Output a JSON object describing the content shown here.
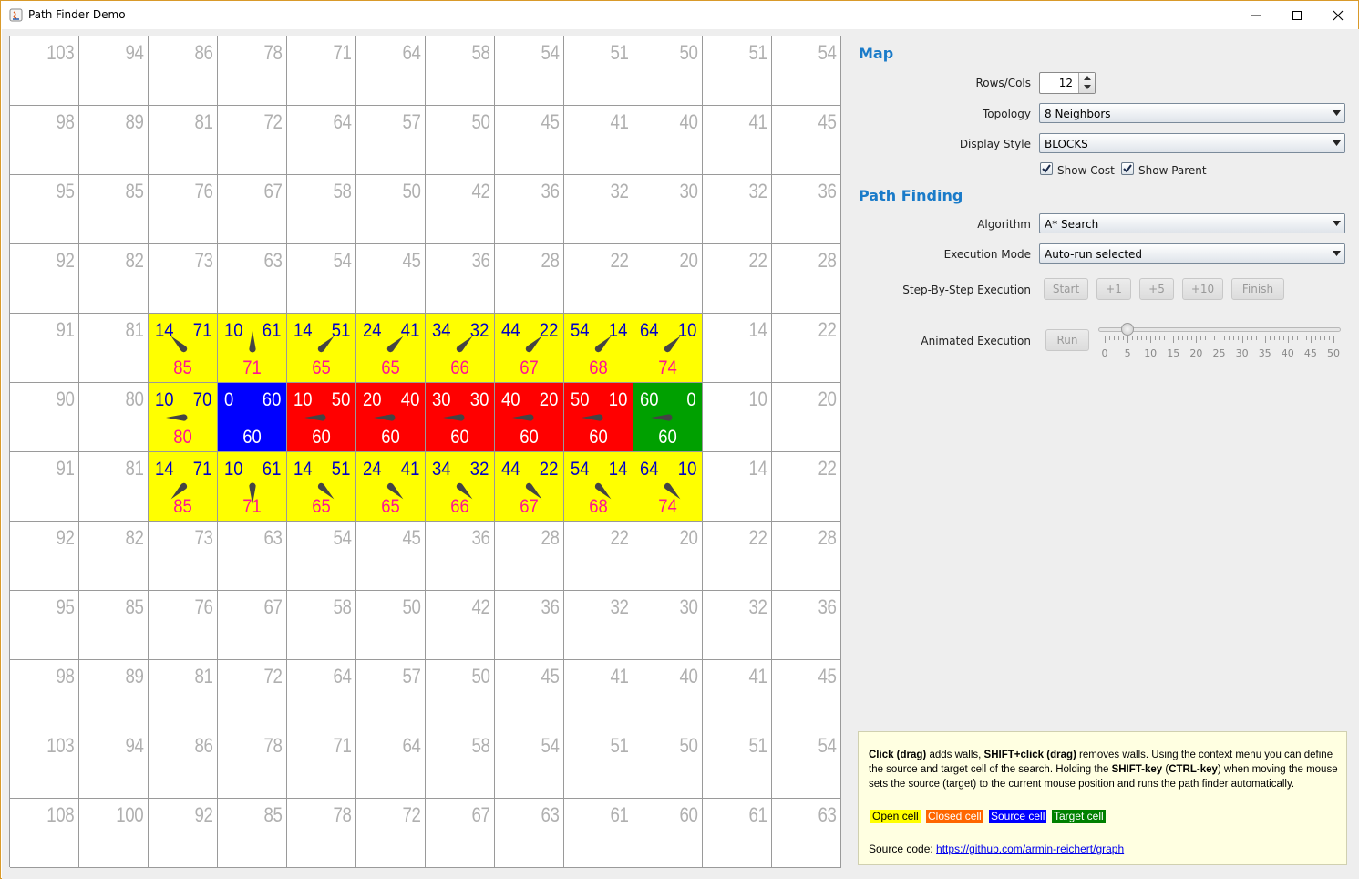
{
  "window": {
    "title": "Path Finder Demo",
    "controls": [
      "minimize",
      "maximize",
      "close"
    ]
  },
  "grid": {
    "rows": 12,
    "cols": 12,
    "h_values": [
      [
        "103",
        "94",
        "86",
        "78",
        "71",
        "64",
        "58",
        "54",
        "51",
        "50",
        "51",
        "54"
      ],
      [
        "98",
        "89",
        "81",
        "72",
        "64",
        "57",
        "50",
        "45",
        "41",
        "40",
        "41",
        "45"
      ],
      [
        "95",
        "85",
        "76",
        "67",
        "58",
        "50",
        "42",
        "36",
        "32",
        "30",
        "32",
        "36"
      ],
      [
        "92",
        "82",
        "73",
        "63",
        "54",
        "45",
        "36",
        "28",
        "22",
        "20",
        "22",
        "28"
      ],
      [
        "91",
        "81",
        "",
        "",
        "",
        "",
        "",
        "",
        "",
        "",
        "14",
        "22"
      ],
      [
        "90",
        "80",
        "",
        "",
        "",
        "",
        "",
        "",
        "",
        "",
        "10",
        "20"
      ],
      [
        "91",
        "81",
        "",
        "",
        "",
        "",
        "",
        "",
        "",
        "",
        "14",
        "22"
      ],
      [
        "92",
        "82",
        "73",
        "63",
        "54",
        "45",
        "36",
        "28",
        "22",
        "20",
        "22",
        "28"
      ],
      [
        "95",
        "85",
        "76",
        "67",
        "58",
        "50",
        "42",
        "36",
        "32",
        "30",
        "32",
        "36"
      ],
      [
        "98",
        "89",
        "81",
        "72",
        "64",
        "57",
        "50",
        "45",
        "41",
        "40",
        "41",
        "45"
      ],
      [
        "103",
        "94",
        "86",
        "78",
        "71",
        "64",
        "58",
        "54",
        "51",
        "50",
        "51",
        "54"
      ],
      [
        "108",
        "100",
        "92",
        "85",
        "78",
        "72",
        "67",
        "63",
        "61",
        "60",
        "61",
        "63"
      ]
    ],
    "special_cells": [
      {
        "row": 4,
        "col": 2,
        "type": "open",
        "g": "14",
        "h": "71",
        "f": "85",
        "dir": "nw"
      },
      {
        "row": 4,
        "col": 3,
        "type": "open",
        "g": "10",
        "h": "61",
        "f": "71",
        "dir": "n"
      },
      {
        "row": 4,
        "col": 4,
        "type": "open",
        "g": "14",
        "h": "51",
        "f": "65",
        "dir": "ne"
      },
      {
        "row": 4,
        "col": 5,
        "type": "open",
        "g": "24",
        "h": "41",
        "f": "65",
        "dir": "ne"
      },
      {
        "row": 4,
        "col": 6,
        "type": "open",
        "g": "34",
        "h": "32",
        "f": "66",
        "dir": "ne"
      },
      {
        "row": 4,
        "col": 7,
        "type": "open",
        "g": "44",
        "h": "22",
        "f": "67",
        "dir": "ne"
      },
      {
        "row": 4,
        "col": 8,
        "type": "open",
        "g": "54",
        "h": "14",
        "f": "68",
        "dir": "ne"
      },
      {
        "row": 4,
        "col": 9,
        "type": "open",
        "g": "64",
        "h": "10",
        "f": "74",
        "dir": "ne"
      },
      {
        "row": 5,
        "col": 2,
        "type": "open",
        "g": "10",
        "h": "70",
        "f": "80",
        "dir": "w"
      },
      {
        "row": 5,
        "col": 3,
        "type": "source",
        "g": "0",
        "h": "60",
        "f": "60",
        "dir": ""
      },
      {
        "row": 5,
        "col": 4,
        "type": "closed",
        "g": "10",
        "h": "50",
        "f": "60",
        "dir": "w"
      },
      {
        "row": 5,
        "col": 5,
        "type": "closed",
        "g": "20",
        "h": "40",
        "f": "60",
        "dir": "w"
      },
      {
        "row": 5,
        "col": 6,
        "type": "closed",
        "g": "30",
        "h": "30",
        "f": "60",
        "dir": "w"
      },
      {
        "row": 5,
        "col": 7,
        "type": "closed",
        "g": "40",
        "h": "20",
        "f": "60",
        "dir": "w"
      },
      {
        "row": 5,
        "col": 8,
        "type": "closed",
        "g": "50",
        "h": "10",
        "f": "60",
        "dir": "w"
      },
      {
        "row": 5,
        "col": 9,
        "type": "target",
        "g": "60",
        "h": "0",
        "f": "60",
        "dir": "w"
      },
      {
        "row": 6,
        "col": 2,
        "type": "open",
        "g": "14",
        "h": "71",
        "f": "85",
        "dir": "sw"
      },
      {
        "row": 6,
        "col": 3,
        "type": "open",
        "g": "10",
        "h": "61",
        "f": "71",
        "dir": "s"
      },
      {
        "row": 6,
        "col": 4,
        "type": "open",
        "g": "14",
        "h": "51",
        "f": "65",
        "dir": "se"
      },
      {
        "row": 6,
        "col": 5,
        "type": "open",
        "g": "24",
        "h": "41",
        "f": "65",
        "dir": "se"
      },
      {
        "row": 6,
        "col": 6,
        "type": "open",
        "g": "34",
        "h": "32",
        "f": "66",
        "dir": "se"
      },
      {
        "row": 6,
        "col": 7,
        "type": "open",
        "g": "44",
        "h": "22",
        "f": "67",
        "dir": "se"
      },
      {
        "row": 6,
        "col": 8,
        "type": "open",
        "g": "54",
        "h": "14",
        "f": "68",
        "dir": "se"
      },
      {
        "row": 6,
        "col": 9,
        "type": "open",
        "g": "64",
        "h": "10",
        "f": "74",
        "dir": "se"
      }
    ]
  },
  "colors": {
    "open": "#ffff00",
    "closed": "#ff0000",
    "source": "#0000ff",
    "target": "#00a000",
    "legend_closed": "#ff6600",
    "section_title": "#1a7bc9"
  },
  "map_section": {
    "title": "Map",
    "rows_cols_label": "Rows/Cols",
    "rows_cols_value": "12",
    "topology_label": "Topology",
    "topology_value": "8 Neighbors",
    "display_style_label": "Display Style",
    "display_style_value": "BLOCKS",
    "show_cost_label": "Show Cost",
    "show_cost_checked": true,
    "show_parent_label": "Show Parent",
    "show_parent_checked": true
  },
  "path_section": {
    "title": "Path Finding",
    "algorithm_label": "Algorithm",
    "algorithm_value": "A* Search",
    "execution_mode_label": "Execution Mode",
    "execution_mode_value": "Auto-run selected",
    "step_label": "Step-By-Step Execution",
    "step_buttons": [
      "Start",
      "+1",
      "+5",
      "+10",
      "Finish"
    ],
    "animated_label": "Animated Execution",
    "run_label": "Run",
    "slider_value": 5,
    "slider_max": 50,
    "slider_ticks": [
      "0",
      "5",
      "10",
      "15",
      "20",
      "25",
      "30",
      "35",
      "40",
      "45",
      "50"
    ]
  },
  "help": {
    "click_bold": "Click (drag)",
    "t1": " adds walls, ",
    "shift_bold": "SHIFT+click (drag)",
    "t2": " removes walls. Using the context menu you can define the source and target cell of the search. Holding the ",
    "shiftkey_bold": "SHIFT-key",
    "t3": " (",
    "ctrlkey_bold": "CTRL-key",
    "t4": ") when moving the mouse sets the source (target) to the current mouse position and runs the path finder automatically.",
    "legend": [
      "Open cell",
      "Closed cell",
      "Source cell",
      "Target cell"
    ],
    "source_label": "Source code: ",
    "source_link": "https://github.com/armin-reichert/graph"
  }
}
